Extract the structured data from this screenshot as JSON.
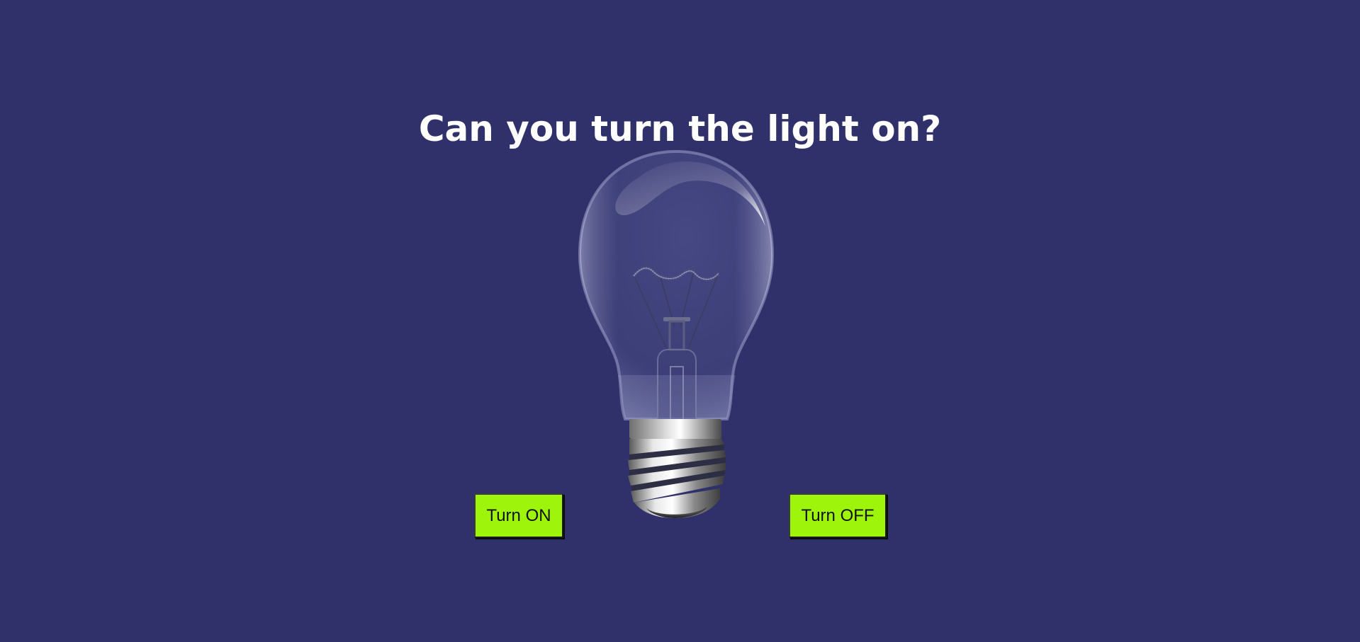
{
  "page": {
    "title": "Can you turn the light on?",
    "background_color": "#30316a"
  },
  "controls": {
    "turn_on_label": "Turn ON",
    "turn_off_label": "Turn OFF",
    "button_color": "#9ef40a"
  },
  "bulb": {
    "icon": "lightbulb-icon",
    "state": "off"
  }
}
